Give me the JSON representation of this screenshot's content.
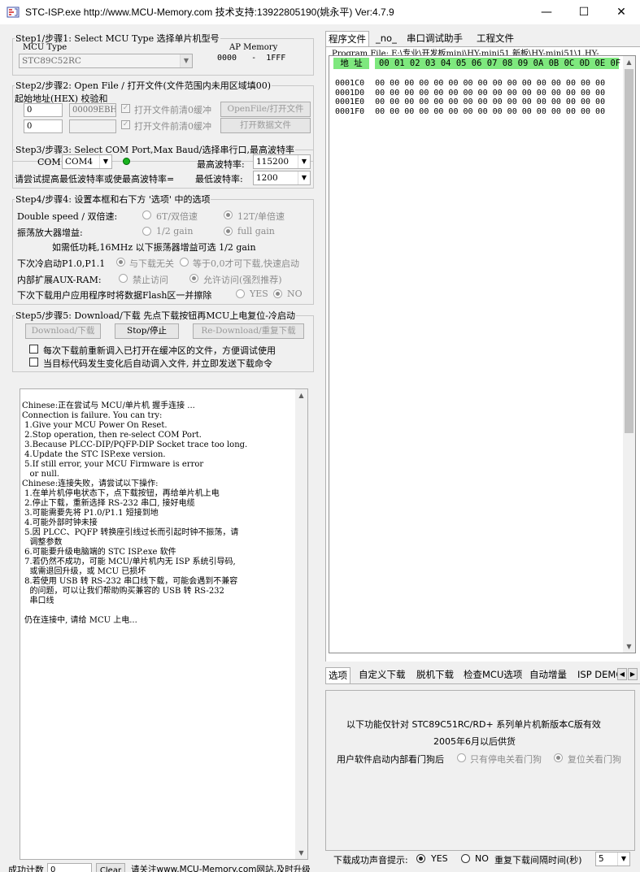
{
  "window": {
    "title": "STC-ISP.exe        http://www.MCU-Memory.com 技术支持:13922805190(姚永平) Ver:4.7.9",
    "minimize": "—",
    "maximize": "☐",
    "close": "✕"
  },
  "step1": {
    "legend": "Step1/步骤1: Select MCU Type  选择单片机型号",
    "mcu_type_label": "MCU Type",
    "mcu_value": "STC89C52RC",
    "ap_memory_label": "AP Memory",
    "ap_memory_range": "0000   -  1FFF"
  },
  "step2": {
    "legend": "Step2/步骤2: Open File / 打开文件(文件范围内未用区域填00)",
    "addr_label": "起始地址(HEX)  校验和",
    "addr1": "0",
    "checksum1": "00009EBH",
    "clear_buffer1_label": "打开文件前清0缓冲",
    "open_file_button": "OpenFile/打开文件",
    "addr2": "0",
    "checksum2": "",
    "clear_buffer2_label": "打开文件前清0缓冲",
    "open_data_button": "打开数据文件"
  },
  "step3": {
    "legend": "Step3/步骤3: Select COM Port,Max Baud/选择串行口,最高波特率",
    "com_label": "COM:",
    "com_value": "COM4",
    "max_baud_label": "最高波特率:",
    "max_baud_value": "115200",
    "hint_label": "请尝试提高最低波特率或使最高波特率=",
    "min_baud_label": "最低波特率:",
    "min_baud_value": "1200",
    "led_on": true
  },
  "step4": {
    "legend": "Step4/步骤4: 设置本框和右下方 '选项' 中的选项",
    "double_speed_label": "Double speed / 双倍速:",
    "opt_6t": "6T/双倍速",
    "opt_12t": "12T/单倍速",
    "opt_6t_checked": false,
    "opt_12t_checked": true,
    "osc_label": "振荡放大器增益:",
    "opt_half_gain": "1/2 gain",
    "opt_full_gain": "full gain",
    "opt_half_checked": false,
    "opt_full_checked": true,
    "osc_note": "如需低功耗,16MHz 以下振荡器增益可选 1/2 gain",
    "cold_boot_label": "下次冷启动P1.0,P1.1",
    "opt_no_relation": "与下载无关",
    "opt_wait_zero": "等于0,0才可下载,快速启动",
    "opt_no_relation_checked": true,
    "opt_wait_zero_checked": false,
    "aux_ram_label": "内部扩展AUX-RAM:",
    "opt_disable_access": "禁止访问",
    "opt_allow_access": "允许访问(强烈推荐)",
    "opt_disable_checked": false,
    "opt_allow_checked": true,
    "erase_flash_label": "下次下载用户应用程序时将数据Flash区一并擦除",
    "opt_yes": "YES",
    "opt_no": "NO",
    "opt_yes_checked": false,
    "opt_no_checked": true
  },
  "step5": {
    "legend": "Step5/步骤5: Download/下载   先点下载按钮再MCU上电复位-冷启动",
    "download_button": "Download/下载",
    "stop_button": "Stop/停止",
    "redownload_button": "Re-Download/重复下载",
    "reload_label": "每次下载前重新调入已打开在缓冲区的文件，方便调试使用",
    "auto_label": "当目标代码发生变化后自动调入文件, 并立即发送下载命令",
    "reload_checked": false,
    "auto_checked": false
  },
  "log": {
    "lines": [
      "Chinese:正在尝试与 MCU/单片机 握手连接 ...",
      "Connection is failure. You can try:",
      " 1.Give your MCU Power On Reset.",
      " 2.Stop operation, then re-select COM Port.",
      " 3.Because PLCC-DIP/PQFP-DIP Socket trace too long.",
      " 4.Update the STC ISP.exe version.",
      " 5.If still error, your MCU Firmware is error",
      "   or null.",
      "Chinese:连接失败，请尝试以下操作:",
      " 1.在单片机停电状态下，点下载按钮，再给单片机上电",
      " 2.停止下载，重新选择 RS-232 串口, 接好电缆",
      " 3.可能需要先将 P1.0/P1.1 短接到地",
      " 4.可能外部时钟未接",
      " 5.因 PLCC、PQFP 转换座引线过长而引起时钟不振荡，请",
      "   调整参数",
      " 6.可能要升级电脑端的 STC ISP.exe 软件",
      " 7.若仍然不成功，可能 MCU/单片机内无 ISP 系统引导码,",
      "   或需退回升级，或 MCU 已损坏",
      " 8.若使用 USB 转 RS-232 串口线下载，可能会遇到不兼容",
      "   的问题，可以让我们帮助购买兼容的 USB 转 RS-232",
      "   串口线",
      "",
      " 仍在连接中, 请给 MCU 上电..."
    ]
  },
  "statusbar": {
    "success_count_label": "成功计数",
    "success_count_value": "0",
    "clear_button": "Clear",
    "notice": "请关注www.MCU-Memory.com网站,及时升级"
  },
  "right_tabs_top": [
    "程序文件",
    "_no_",
    "串口调试助手",
    "工程文件"
  ],
  "program_file": {
    "path_label": "Program File: E:\\专业\\开发板mini\\HY-mini51 新板\\HY-mini51\\1.HY-",
    "addr_header": "地 址",
    "cols_header": "00 01 02 03 04 05 06 07 08 09 0A 0B 0C 0D 0E 0F",
    "rows": [
      {
        "addr": "0001C0",
        "bytes": "00 00 00 00 00 00 00 00 00 00 00 00 00 00 00 00"
      },
      {
        "addr": "0001D0",
        "bytes": "00 00 00 00 00 00 00 00 00 00 00 00 00 00 00 00"
      },
      {
        "addr": "0001E0",
        "bytes": "00 00 00 00 00 00 00 00 00 00 00 00 00 00 00 00"
      },
      {
        "addr": "0001F0",
        "bytes": "00 00 00 00 00 00 00 00 00 00 00 00 00 00 00 00"
      }
    ]
  },
  "right_tabs_bottom": [
    "选项",
    "自定义下载",
    "脱机下载",
    "检查MCU选项",
    "自动增量",
    "ISP DEMO"
  ],
  "options_panel": {
    "line1": "以下功能仅针对 STC89C51RC/RD+ 系列单片机新版本C版有效",
    "line2": "2005年6月以后供货",
    "watchdog_label": "用户软件启动内部看门狗后",
    "opt_power_off": "只有停电关看门狗",
    "opt_reset": "复位关看门狗",
    "opt_power_off_checked": false,
    "opt_reset_checked": true,
    "sound_label": "下载成功声音提示:",
    "opt_yes": "YES",
    "opt_no": "NO",
    "opt_yes_checked": true,
    "opt_no_checked": false,
    "interval_label": "重复下载间隔时间(秒)",
    "interval_value": "5"
  },
  "icons": {
    "scroll_up": "▲",
    "scroll_down": "▼",
    "tab_left": "◀",
    "tab_right": "▶",
    "dropdown": "▼",
    "check": "✓"
  }
}
